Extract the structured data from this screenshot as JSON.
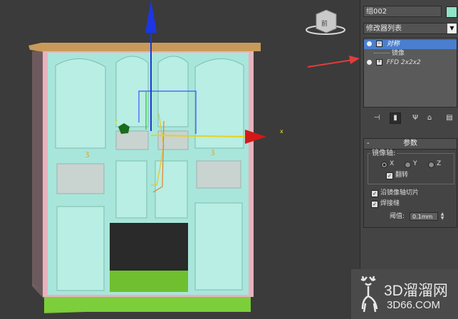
{
  "viewport": {
    "axis_label_x": "x",
    "axis_label_y": "y",
    "viewcube_label": "前"
  },
  "panel": {
    "object_name": "组002",
    "object_color": "#8fe3c7",
    "modifier_list": "修改器列表",
    "stack": [
      {
        "label": "对称",
        "selected": true
      },
      {
        "label": "镜像",
        "selected": false
      },
      {
        "label": "FFD 2x2x2",
        "selected": false
      }
    ],
    "params": {
      "title": "参数",
      "mirror_axis_label": "镜像轴:",
      "axis_x": "X",
      "axis_y": "Y",
      "axis_z": "Z",
      "flip_label": "翻转",
      "slice_label": "沿镜像轴切片",
      "weld_label": "焊接缝",
      "threshold_label": "阈值:",
      "threshold_value": "0.1mm"
    }
  },
  "watermark": {
    "text": "3D溜溜网",
    "url": "3D66.COM"
  }
}
